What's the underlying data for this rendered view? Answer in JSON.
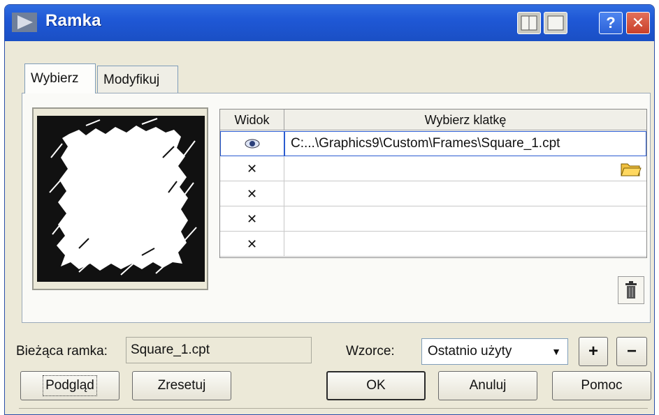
{
  "window": {
    "title": "Ramka"
  },
  "titlebar_buttons": {
    "help": "?",
    "close": "✕"
  },
  "tabs": [
    {
      "label": "Wybierz",
      "active": true
    },
    {
      "label": "Modyfikuj",
      "active": false
    }
  ],
  "grid": {
    "headers": [
      "Widok",
      "Wybierz klatkę"
    ],
    "rows": [
      {
        "visible": true,
        "path": "C:...\\Graphics9\\Custom\\Frames\\Square_1.cpt"
      },
      {
        "visible": false,
        "path": ""
      },
      {
        "visible": false,
        "path": ""
      },
      {
        "visible": false,
        "path": ""
      },
      {
        "visible": false,
        "path": ""
      }
    ],
    "x_glyph": "✕"
  },
  "current_frame": {
    "label": "Bieżąca ramka:",
    "value": "Square_1.cpt"
  },
  "patterns": {
    "label": "Wzorce:",
    "selected": "Ostatnio użyty",
    "add_label": "+",
    "remove_label": "−"
  },
  "buttons": {
    "preview": "Podgląd",
    "reset": "Zresetuj",
    "ok": "OK",
    "cancel": "Anuluj",
    "help": "Pomoc"
  },
  "colors": {
    "titlebar": "#1f58d6",
    "window": "#ece9d8",
    "selection": "#2a5bd0"
  }
}
